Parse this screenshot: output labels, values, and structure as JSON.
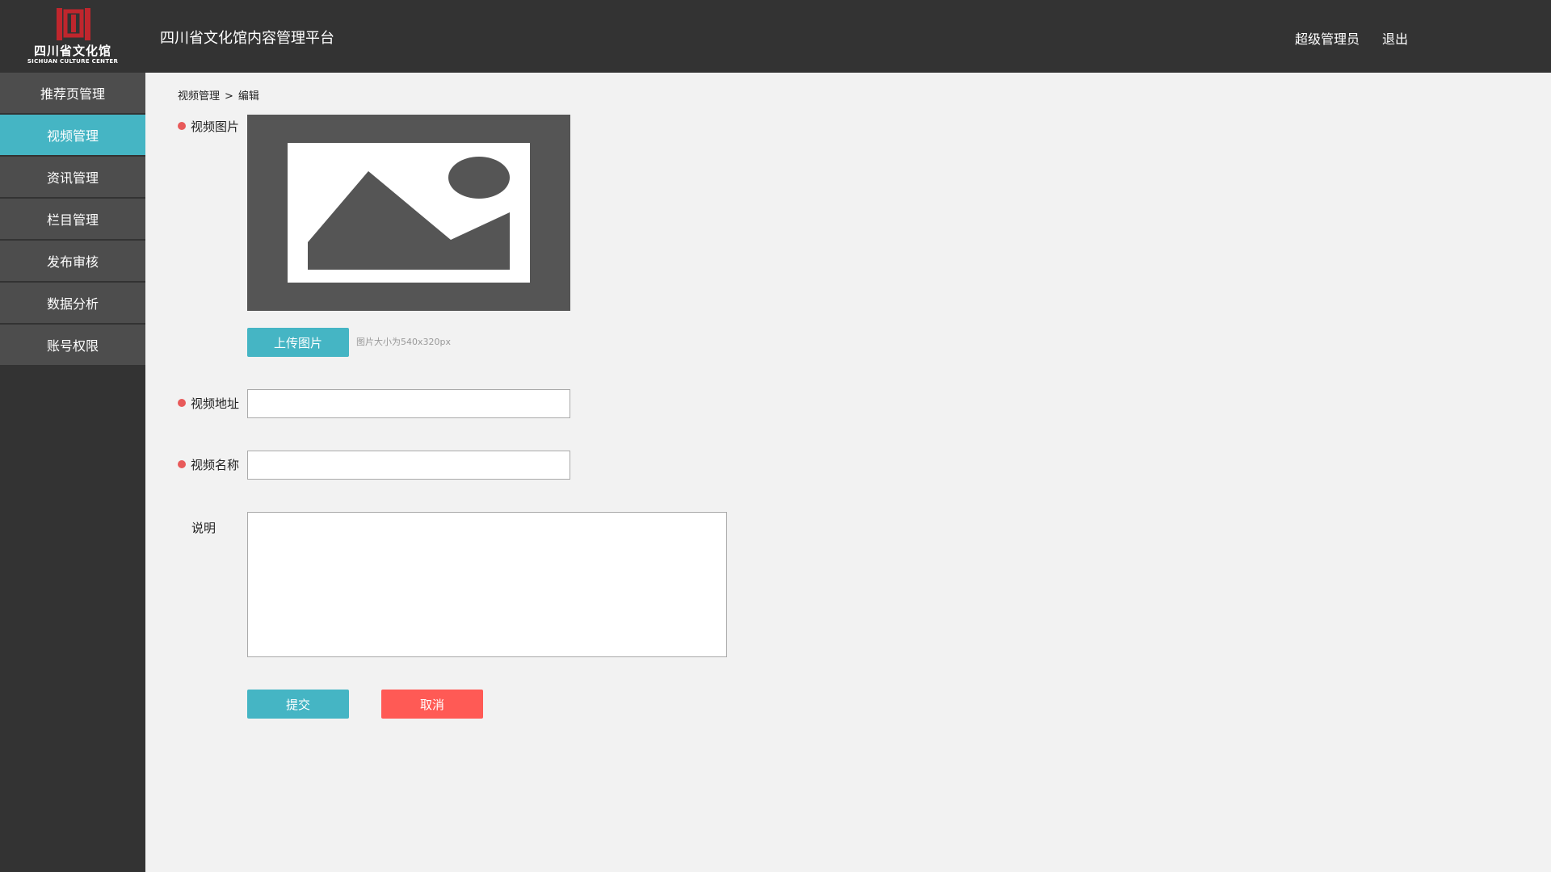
{
  "header": {
    "logo_cn": "四川省文化馆",
    "logo_en": "SICHUAN CULTURE CENTER",
    "title": "四川省文化馆内容管理平台",
    "user": "超级管理员",
    "logout": "退出"
  },
  "sidebar": {
    "items": [
      {
        "label": "推荐页管理"
      },
      {
        "label": "视频管理",
        "active": true
      },
      {
        "label": "资讯管理"
      },
      {
        "label": "栏目管理"
      },
      {
        "label": "发布审核"
      },
      {
        "label": "数据分析"
      },
      {
        "label": "账号权限"
      }
    ]
  },
  "breadcrumb": {
    "parent": "视频管理",
    "separator": ">",
    "current": "编辑"
  },
  "form": {
    "image_label": "视频图片",
    "upload_button": "上传图片",
    "image_hint": "图片大小为540x320px",
    "url_label": "视频地址",
    "url_value": "",
    "name_label": "视频名称",
    "name_value": "",
    "desc_label": "说明",
    "desc_value": "",
    "submit": "提交",
    "cancel": "取消"
  },
  "colors": {
    "header_bg": "#333333",
    "accent": "#45b5c4",
    "danger": "#ff5a55",
    "required": "#e85a5a",
    "logo_red": "#c0262d"
  }
}
